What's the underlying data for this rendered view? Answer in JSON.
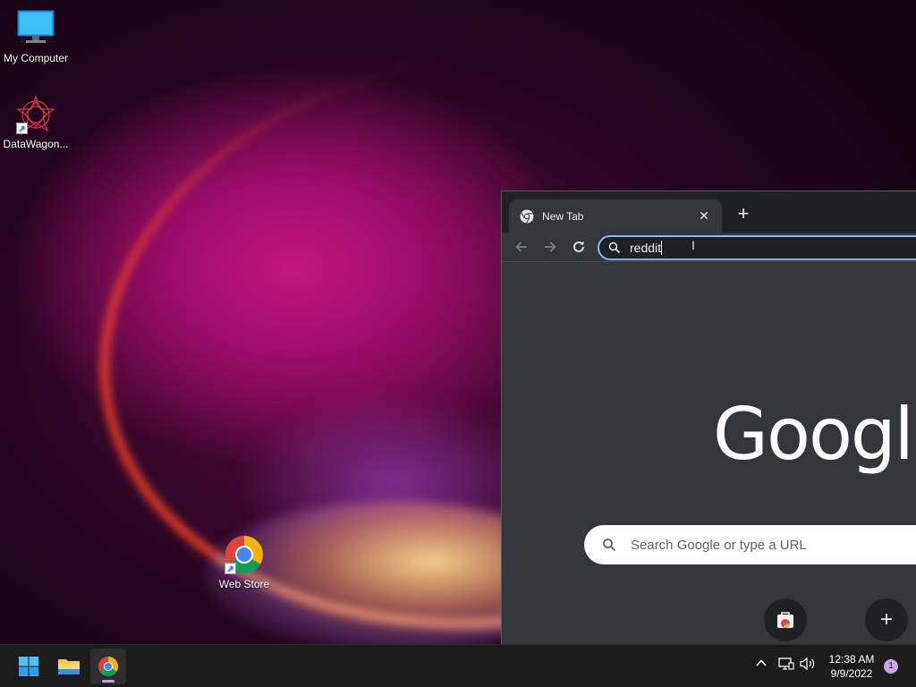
{
  "desktop": {
    "icons": [
      {
        "label": "My Computer",
        "icon": "monitor-icon"
      },
      {
        "label": "DataWagon...",
        "icon": "datawagon-logo-icon"
      },
      {
        "label": "Web Store",
        "icon": "chrome-webstore-icon"
      }
    ]
  },
  "browser": {
    "tab": {
      "title": "New Tab",
      "close_glyph": "✕"
    },
    "new_tab_glyph": "+",
    "omnibox": {
      "value": "reddit"
    },
    "ntp": {
      "logo_text": "Googl",
      "search_placeholder": "Search Google or type a URL",
      "add_shortcut_glyph": "+"
    }
  },
  "taskbar": {
    "apps": [
      "windows-start-icon",
      "file-explorer-icon",
      "chrome-icon"
    ],
    "clock": {
      "time": "12:38 AM",
      "date": "9/9/2022"
    },
    "notification_count": "1",
    "tray": {
      "chevron": "^"
    }
  },
  "colors": {
    "accent": "#8ab4f8",
    "browser_bg": "#35363a",
    "tabstrip_bg": "#202124",
    "taskbar_bg": "#1c1c1c"
  }
}
